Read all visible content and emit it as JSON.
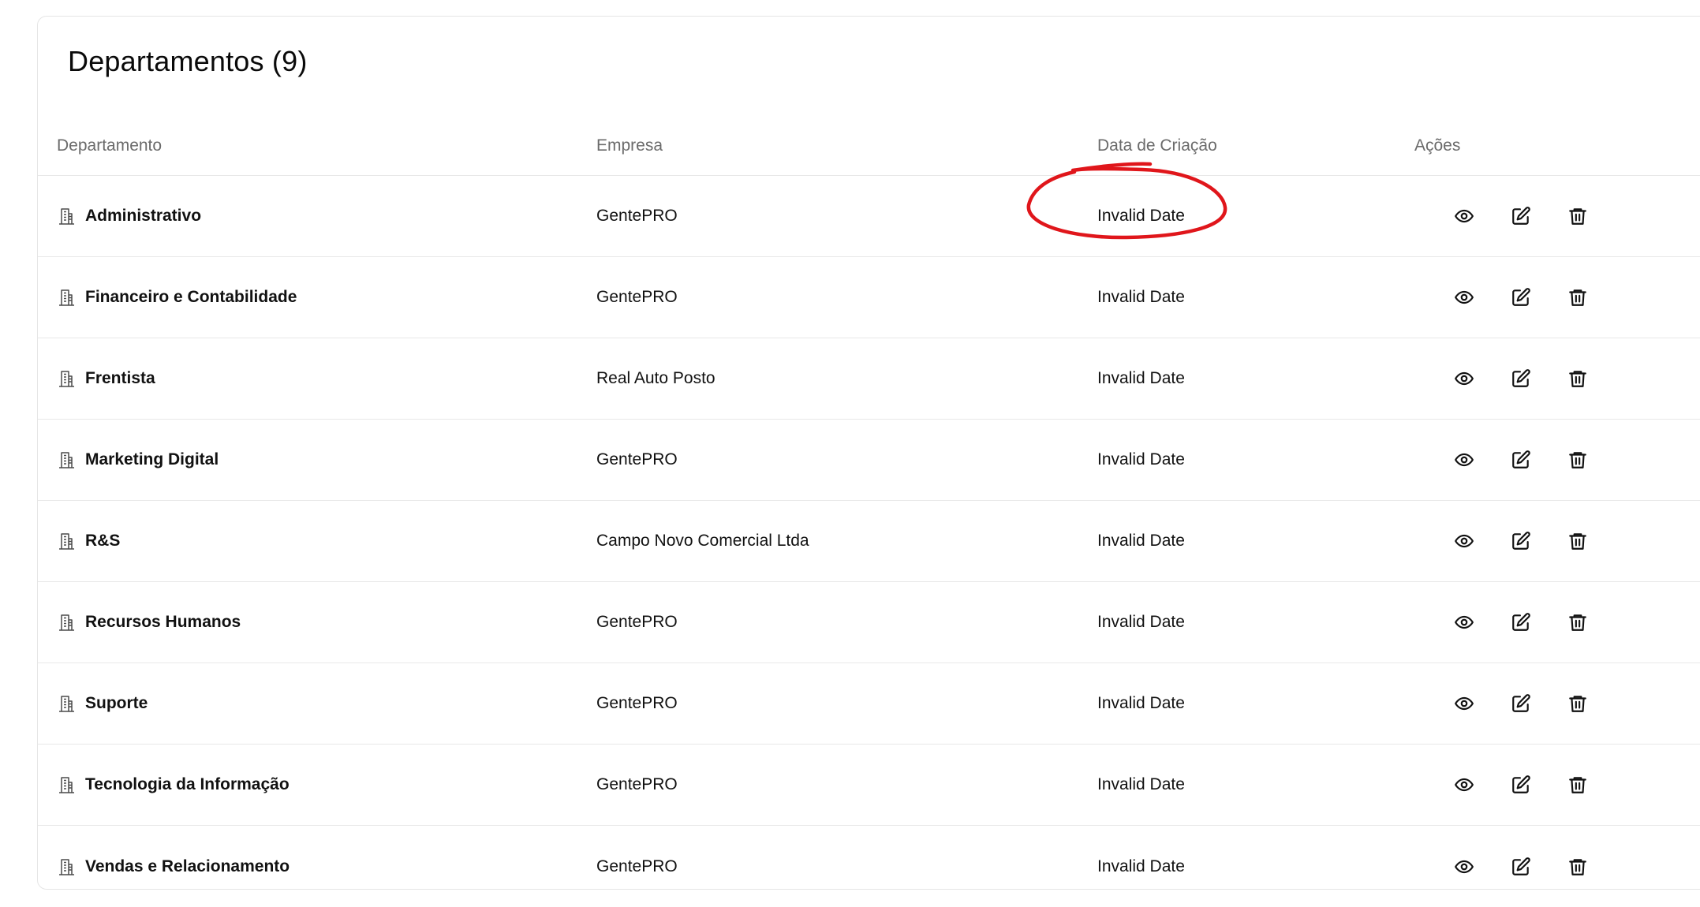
{
  "card": {
    "title": "Departamentos (9)"
  },
  "table": {
    "headers": [
      "Departamento",
      "Empresa",
      "Data de Criação",
      "Ações"
    ],
    "rows": [
      {
        "departamento": "Administrativo",
        "empresa": "GentePRO",
        "data": "Invalid Date"
      },
      {
        "departamento": "Financeiro e Contabilidade",
        "empresa": "GentePRO",
        "data": "Invalid Date"
      },
      {
        "departamento": "Frentista",
        "empresa": "Real Auto Posto",
        "data": "Invalid Date"
      },
      {
        "departamento": "Marketing Digital",
        "empresa": "GentePRO",
        "data": "Invalid Date"
      },
      {
        "departamento": "R&S",
        "empresa": "Campo Novo Comercial Ltda",
        "data": "Invalid Date"
      },
      {
        "departamento": "Recursos Humanos",
        "empresa": "GentePRO",
        "data": "Invalid Date"
      },
      {
        "departamento": "Suporte",
        "empresa": "GentePRO",
        "data": "Invalid Date"
      },
      {
        "departamento": "Tecnologia da Informação",
        "empresa": "GentePRO",
        "data": "Invalid Date"
      },
      {
        "departamento": "Vendas e Relacionamento",
        "empresa": "GentePRO",
        "data": "Invalid Date"
      }
    ],
    "row_icon": "building-icon",
    "action_icons": [
      "eye-icon",
      "edit-icon",
      "trash-icon"
    ]
  },
  "colors": {
    "annotation": "#e0161b",
    "header_text": "#6b6b6b",
    "border": "#e8e8e8"
  }
}
